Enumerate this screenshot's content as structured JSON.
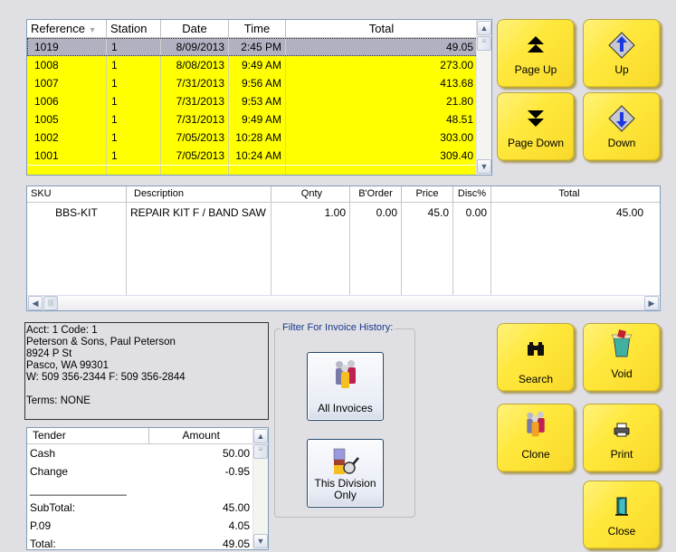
{
  "invoice_list": {
    "columns": [
      "Reference",
      "Station",
      "Date",
      "Time",
      "Total"
    ],
    "rows": [
      {
        "reference": "1019",
        "station": "1",
        "date": "8/09/2013",
        "time": "2:45 PM",
        "total": "49.05",
        "selected": true
      },
      {
        "reference": "1008",
        "station": "1",
        "date": "8/08/2013",
        "time": "9:49 AM",
        "total": "273.00"
      },
      {
        "reference": "1007",
        "station": "1",
        "date": "7/31/2013",
        "time": "9:56 AM",
        "total": "413.68"
      },
      {
        "reference": "1006",
        "station": "1",
        "date": "7/31/2013",
        "time": "9:53 AM",
        "total": "21.80"
      },
      {
        "reference": "1005",
        "station": "1",
        "date": "7/31/2013",
        "time": "9:49 AM",
        "total": "48.51"
      },
      {
        "reference": "1002",
        "station": "1",
        "date": "7/05/2013",
        "time": "10:28 AM",
        "total": "303.00"
      },
      {
        "reference": "1001",
        "station": "1",
        "date": "7/05/2013",
        "time": "10:24 AM",
        "total": "309.40"
      }
    ],
    "highlight_color": "#ffff00",
    "selected_color": "#b0b2c2"
  },
  "nav_buttons": {
    "page_up": "Page Up",
    "up": "Up",
    "page_down": "Page Down",
    "down": "Down"
  },
  "detail_list": {
    "columns": [
      "SKU",
      "Description",
      "Qnty",
      "B'Order",
      "Price",
      "Disc%",
      "Total"
    ],
    "rows": [
      {
        "sku": "BBS-KIT",
        "description": "REPAIR KIT F / BAND SAW",
        "qnty": "1.00",
        "border": "0.00",
        "price": "45.0",
        "disc": "0.00",
        "total": "45.00"
      }
    ]
  },
  "customer": {
    "line1": "Acct: 1  Code: 1",
    "line2": "Peterson & Sons, Paul Peterson",
    "line3": "8924 P St",
    "line4": "Pasco, WA   99301",
    "line5": "W: 509 356-2344 F: 509 356-2844",
    "terms": "Terms: NONE"
  },
  "tender": {
    "columns": [
      "Tender",
      "Amount"
    ],
    "rows": [
      {
        "label": "Cash",
        "amount": "50.00"
      },
      {
        "label": "Change",
        "amount": "-0.95"
      },
      {
        "label": "________________",
        "amount": ""
      },
      {
        "label": "SubTotal:",
        "amount": "45.00"
      },
      {
        "label": "P.09",
        "amount": "4.05"
      },
      {
        "label": "Total:",
        "amount": "49.05"
      }
    ]
  },
  "filter": {
    "legend": "Filter For Invoice History:",
    "all_invoices": "All Invoices",
    "this_division_line1": "This Division",
    "this_division_line2": "Only"
  },
  "action_buttons": {
    "search": "Search",
    "void": "Void",
    "clone": "Clone",
    "print": "Print",
    "close": "Close"
  },
  "colors": {
    "button_yellow": "#ffe83c",
    "nav_arrow_blue": "#1a3ae0"
  }
}
